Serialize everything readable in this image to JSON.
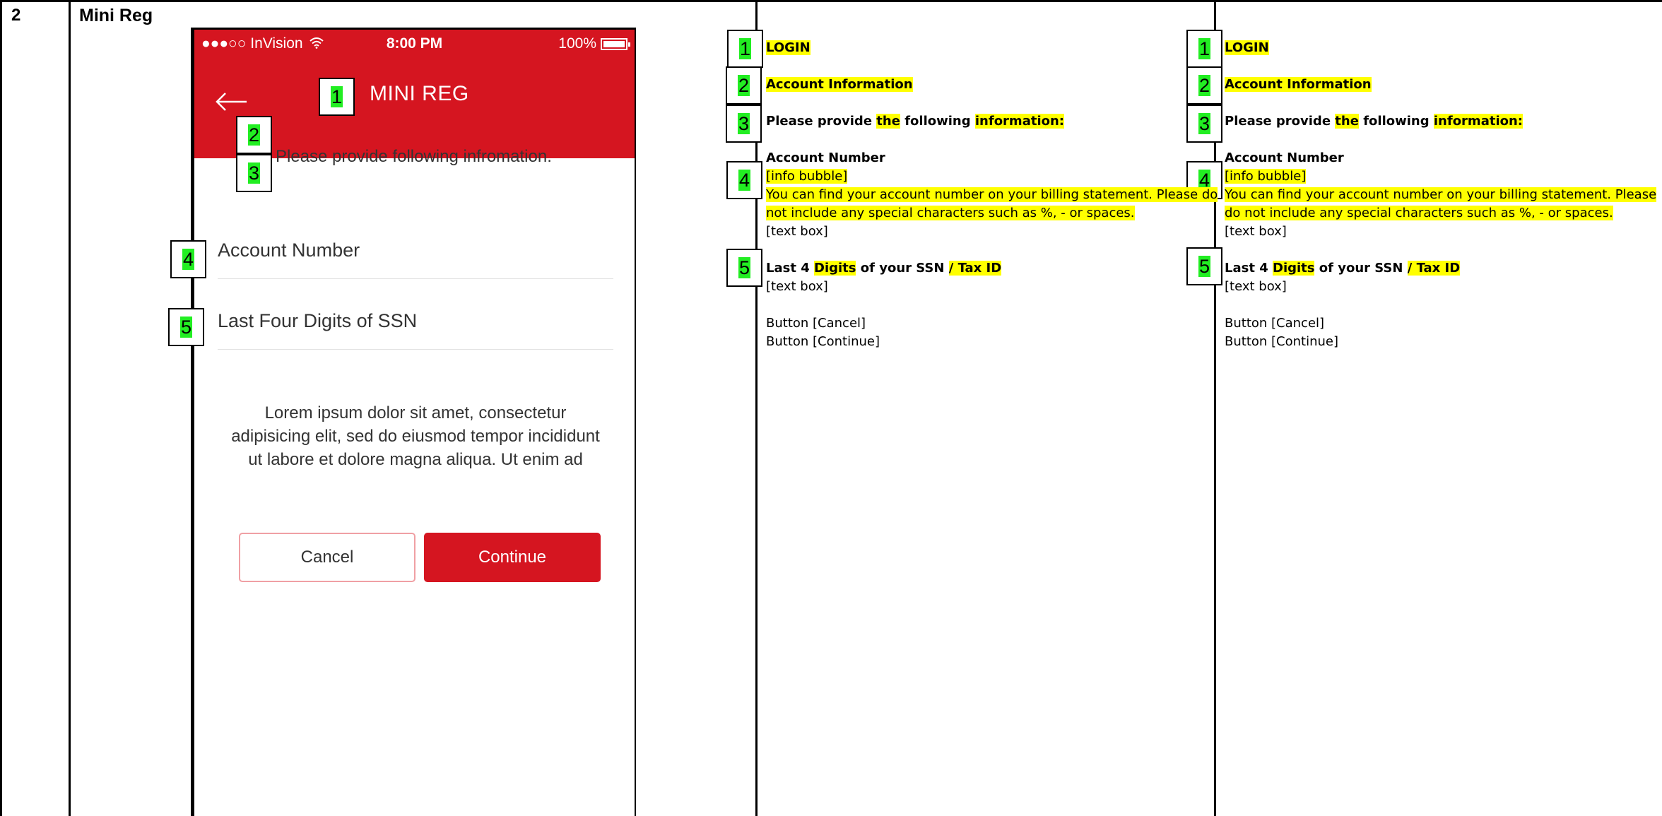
{
  "row": {
    "number": "2",
    "title": "Mini Reg"
  },
  "phone": {
    "status_bar": {
      "carrier": "●●●○○ InVision",
      "time": "8:00 PM",
      "battery": "100%"
    },
    "nav_title": "MINI REG",
    "instruction": "Please provide following infromation.",
    "account_label": "Account Number",
    "ssn_label": "Last Four Digits of SSN",
    "lorem_lines": [
      "Lorem ipsum dolor sit amet, consectetur",
      "adipisicing elit, sed do eiusmod tempor incididunt",
      "ut labore et dolore magna aliqua. Ut enim ad"
    ],
    "cancel_label": "Cancel",
    "continue_label": "Continue"
  },
  "markers": [
    "1",
    "2",
    "3",
    "4",
    "5"
  ],
  "spec_columns": [
    {
      "login": "LOGIN",
      "account_info": "Account Information",
      "provide_a": "Please provide ",
      "provide_the": "the",
      "provide_b": " following ",
      "provide_info": "information:",
      "account_number": "Account Number",
      "info_bubble": "[info bubble]",
      "help_line1": "You can find your account number on your billing statement. Please do",
      "help_line2": "not include any special characters such as %, - or spaces.",
      "text_box_1": " [text box]",
      "last4_a": "Last 4 ",
      "digits": "Digits",
      "last4_b": " of your SSN ",
      "tax_id": "/ Tax ID",
      "text_box_2": "[text box]",
      "button_cancel": "Button [Cancel]",
      "button_continue": "Button [Continue]"
    },
    {
      "login": "LOGIN",
      "account_info": "Account Information",
      "provide_a": "Please provide ",
      "provide_the": "the",
      "provide_b": " following ",
      "provide_info": "information:",
      "account_number": "Account Number",
      "info_bubble": "[info bubble]",
      "help_line1": "You can find your account number on your billing statement. Please",
      "help_line2": "do not include any special characters such as %, - or spaces.",
      "text_box_1": " [text box]",
      "last4_a": "Last 4 ",
      "digits": "Digits",
      "last4_b": " of your SSN ",
      "tax_id": "/ Tax ID",
      "text_box_2": "[text box]",
      "button_cancel": "Button [Cancel]",
      "button_continue": "Button [Continue]"
    }
  ],
  "colors": {
    "brand_red": "#d51520",
    "highlight_yellow": "#ffff00",
    "marker_green": "#22ee22"
  }
}
